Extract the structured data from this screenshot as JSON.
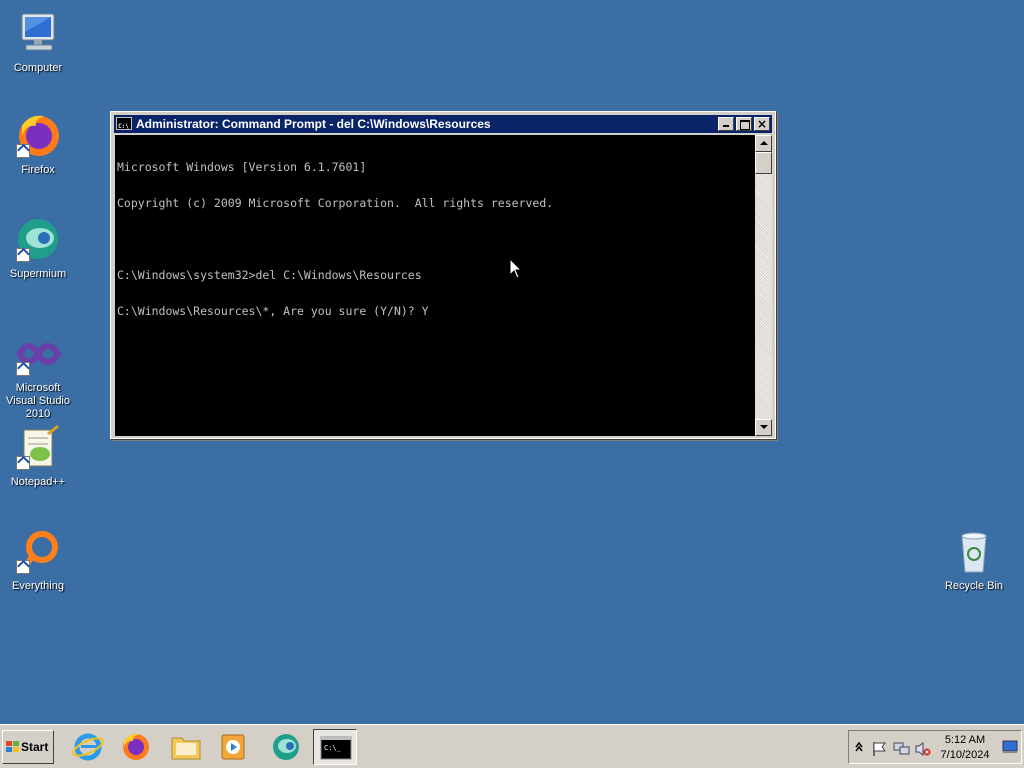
{
  "desktop": {
    "icons": [
      {
        "label": "Computer"
      },
      {
        "label": "Firefox"
      },
      {
        "label": "Supermium"
      },
      {
        "label": "Microsoft Visual Studio 2010"
      },
      {
        "label": "Notepad++"
      },
      {
        "label": "Everything"
      },
      {
        "label": "Recycle Bin"
      }
    ]
  },
  "window": {
    "title": "Administrator: Command Prompt - del  C:\\Windows\\Resources",
    "console_lines": [
      "Microsoft Windows [Version 6.1.7601]",
      "Copyright (c) 2009 Microsoft Corporation.  All rights reserved.",
      "",
      "C:\\Windows\\system32>del C:\\Windows\\Resources",
      "C:\\Windows\\Resources\\*, Are you sure (Y/N)? Y"
    ],
    "close_glyph": "×"
  },
  "taskbar": {
    "start_label": "Start",
    "apps": [
      "internet-explorer",
      "firefox",
      "file-explorer",
      "media-player",
      "supermium",
      "command-prompt"
    ],
    "tray": {
      "time": "5:12 AM",
      "date": "7/10/2024"
    }
  },
  "colors": {
    "desktop": "#3a6ea5",
    "titlebar": "#0a246a",
    "console_bg": "#000000",
    "console_fg": "#c0c0c0"
  }
}
